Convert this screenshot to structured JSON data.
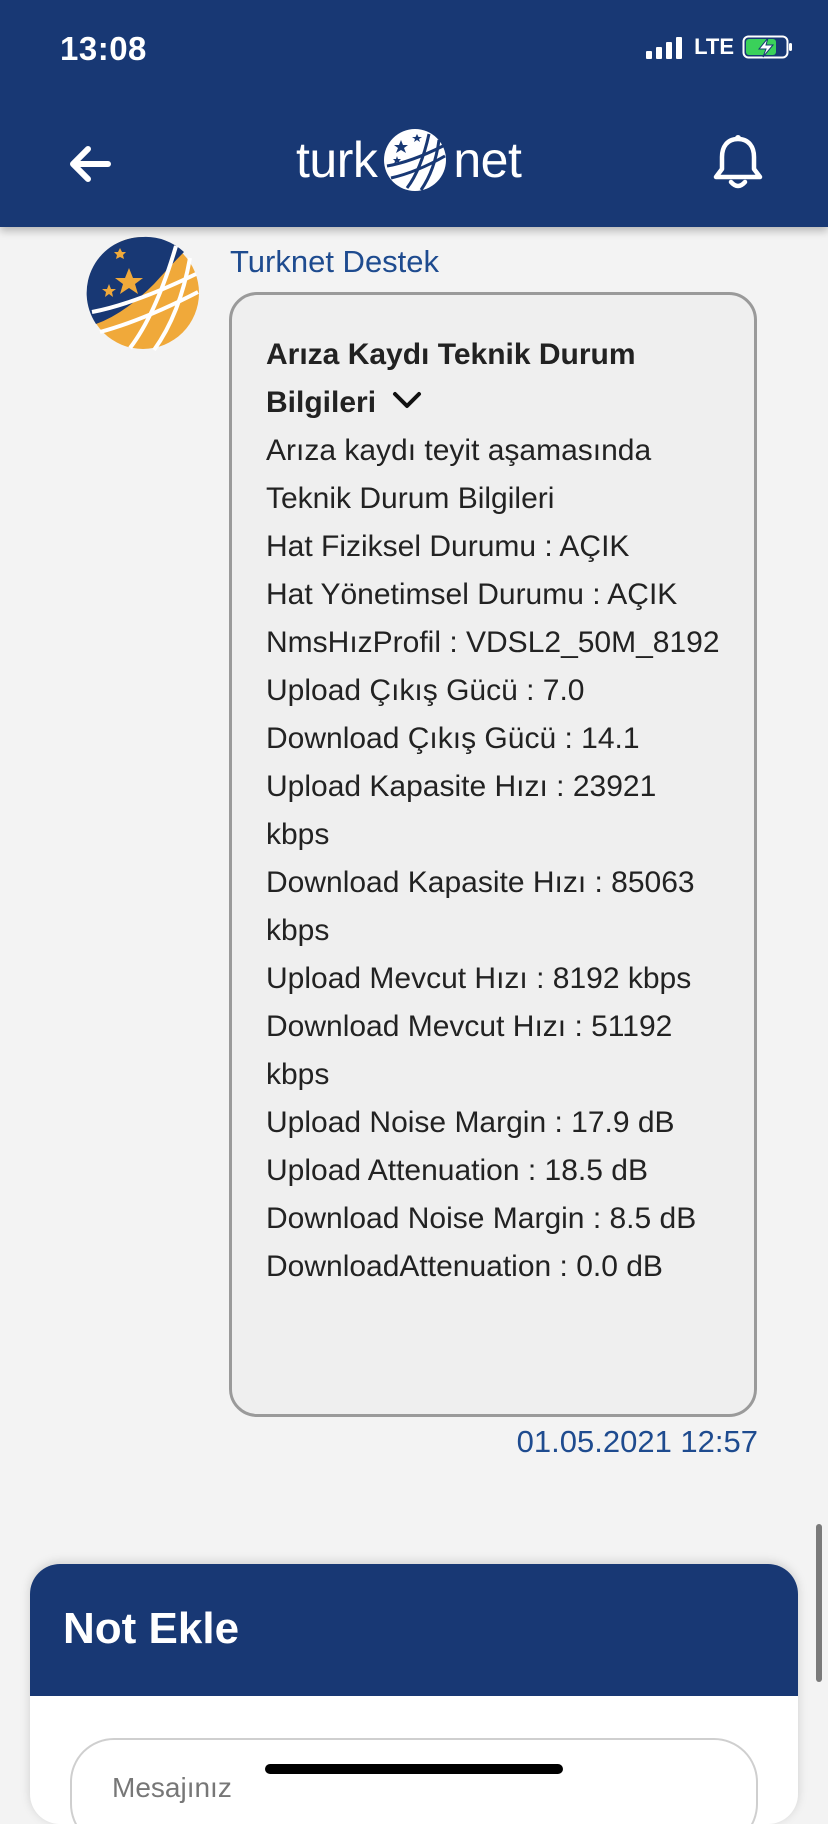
{
  "status_bar": {
    "time": "13:08",
    "network": "LTE"
  },
  "header": {
    "logo_left": "turk",
    "logo_right": "net",
    "icons": {
      "back": "arrow-left-icon",
      "bell": "bell-icon"
    }
  },
  "message": {
    "sender": "Turknet Destek",
    "title": "Arıza Kaydı Teknik Durum Bilgileri",
    "lines": [
      "Arıza kaydı teyit aşamasında",
      "Teknik Durum Bilgileri",
      "Hat Fiziksel Durumu : AÇIK",
      "Hat Yönetimsel Durumu : AÇIK",
      "NmsHızProfil : VDSL2_50M_8192",
      "Upload Çıkış Gücü : 7.0",
      "Download Çıkış Gücü : 14.1",
      "Upload Kapasite Hızı : 23921 kbps",
      "Download Kapasite Hızı : 85063 kbps",
      "Upload Mevcut Hızı : 8192 kbps",
      "Download Mevcut Hızı : 51192 kbps",
      "Upload Noise Margin : 17.9 dB",
      "Upload Attenuation : 18.5 dB",
      "Download Noise Margin : 8.5 dB",
      "DownloadAttenuation : 0.0 dB"
    ],
    "timestamp": "01.05.2021 12:57"
  },
  "note": {
    "title": "Not Ekle",
    "placeholder": "Mesajınız"
  },
  "colors": {
    "primary": "#183874",
    "link": "#1e4b8f",
    "background": "#f3f3f3",
    "bubble": "#efefef",
    "logo_orange": "#f0a93a"
  }
}
